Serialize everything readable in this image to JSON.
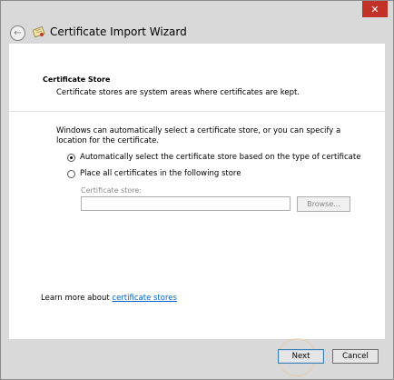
{
  "window": {
    "title": "Certificate Import Wizard",
    "close_glyph": "✕",
    "back_glyph": "←"
  },
  "header": {
    "title": "Certificate Store",
    "description": "Certificate stores are system areas where certificates are kept."
  },
  "body": {
    "intro": "Windows can automatically select a certificate store, or you can specify a location for the certificate.",
    "options": [
      {
        "label": "Automatically select the certificate store based on the type of certificate",
        "selected": true
      },
      {
        "label": "Place all certificates in the following store",
        "selected": false
      }
    ],
    "store_label": "Certificate store:",
    "store_value": "",
    "browse_label": "Browse..."
  },
  "footer": {
    "learn_prefix": "Learn more about ",
    "learn_link": "certificate stores",
    "next_label": "Next",
    "cancel_label": "Cancel"
  },
  "colors": {
    "close_button": "#c13127",
    "link": "#0066cc",
    "frame": "#d9d9d9"
  },
  "icons": [
    "back-arrow-icon",
    "certificate-icon",
    "close-icon"
  ]
}
